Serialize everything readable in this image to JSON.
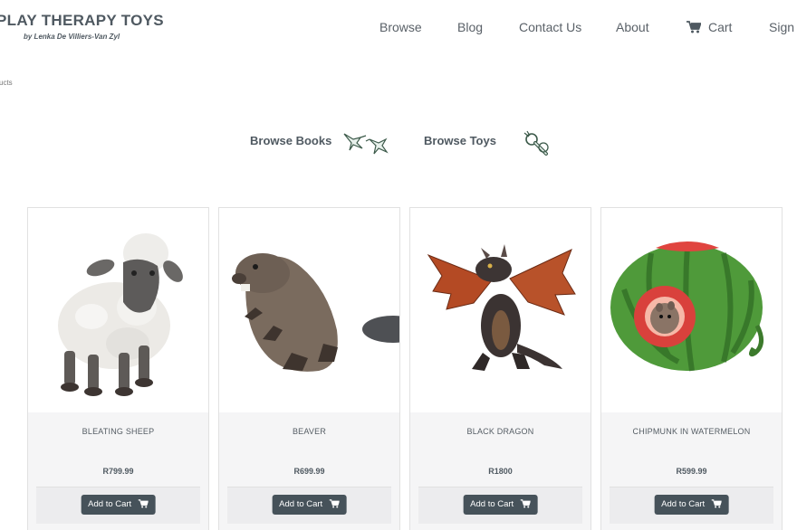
{
  "brand": {
    "title": "PLAY THERAPY TOYS",
    "subtitle": "by Lenka De Villiers-Van Zyl"
  },
  "nav": {
    "browse": "Browse",
    "blog": "Blog",
    "contact": "Contact Us",
    "about": "About",
    "cart": "Cart",
    "sign": "Sign"
  },
  "breadcrumb": "ucts",
  "browse_links": {
    "books": "Browse Books",
    "toys": "Browse Toys"
  },
  "products": [
    {
      "name": "BLEATING SHEEP",
      "price": "R799.99",
      "button": "Add to Cart"
    },
    {
      "name": "BEAVER",
      "price": "R699.99",
      "button": "Add to Cart"
    },
    {
      "name": "BLACK DRAGON",
      "price": "R1800",
      "button": "Add to Cart"
    },
    {
      "name": "CHIPMUNK IN WATERMELON",
      "price": "R599.99",
      "button": "Add to Cart"
    }
  ],
  "icons": {
    "cart": "cart-icon",
    "books": "hummingbird-icon",
    "toys": "magnifier-icon"
  },
  "colors": {
    "button": "#46525a",
    "text": "#4f5961",
    "card_body": "#f5f5f6"
  }
}
